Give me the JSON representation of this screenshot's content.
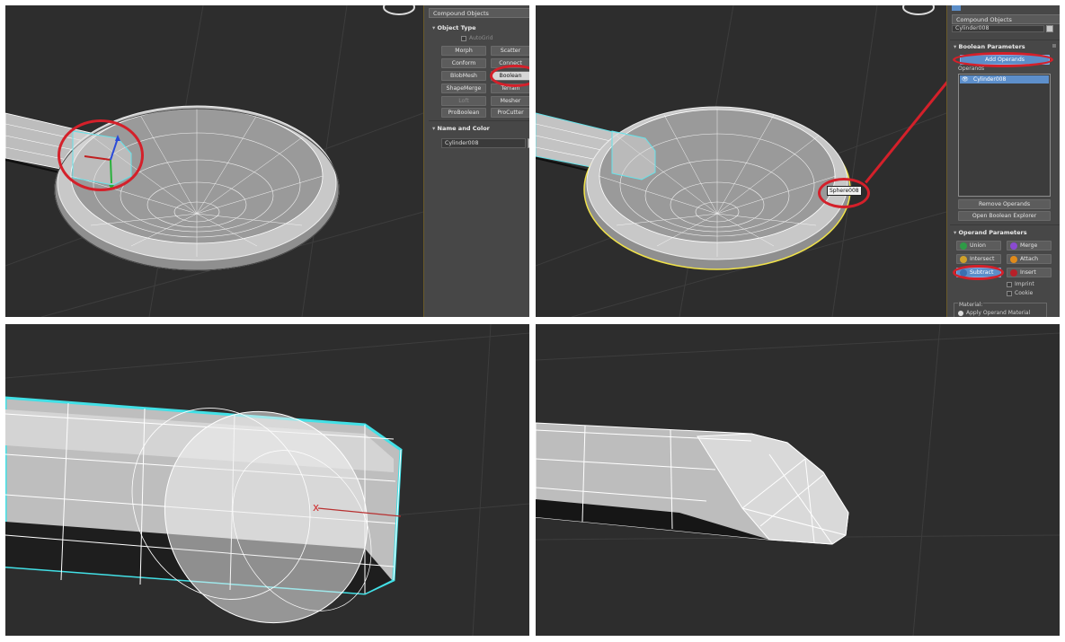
{
  "colors": {
    "viewport_bg": "#2d2d2d",
    "panel_bg": "#474747",
    "selected_blue": "#5c8ec9",
    "highlight_red": "#d4202a",
    "selection_yellow": "#f0e24a",
    "selection_cyan": "#42e0e6"
  },
  "top_left": {
    "panel": {
      "category_dropdown": "Compound Objects",
      "object_type": {
        "title": "Object Type",
        "autogrid_label": "AutoGrid",
        "buttons": {
          "morph": "Morph",
          "scatter": "Scatter",
          "conform": "Conform",
          "connect": "Connect",
          "blobmesh": "BlobMesh",
          "boolean": "Boolean",
          "shapemerge": "ShapeMerge",
          "terrain": "Terrain",
          "loft": "Loft",
          "mesher": "Mesher",
          "proboolean": "ProBoolean",
          "procutter": "ProCutter"
        }
      },
      "name_and_color": {
        "title": "Name and Color",
        "name_value": "Cylinder008"
      }
    }
  },
  "top_right": {
    "tooltip": "Sphere008",
    "panel": {
      "category_dropdown": "Compound Objects",
      "name_field": "Cylinder008",
      "boolean_parameters": {
        "title": "Boolean Parameters",
        "add_operands": "Add Operands",
        "operands_label": "Operands",
        "operand_item": "Cylinder008",
        "remove_operands": "Remove Operands",
        "open_explorer": "Open Boolean Explorer"
      },
      "operand_parameters": {
        "title": "Operand Parameters",
        "union": "Union",
        "merge": "Merge",
        "intersect": "Intersect",
        "attach": "Attach",
        "subtract": "Subtract",
        "insert": "Insert",
        "imprint": "Imprint",
        "cookie": "Cookie",
        "material_label": "Material:",
        "apply_operand_material": "Apply Operand Material"
      }
    }
  }
}
